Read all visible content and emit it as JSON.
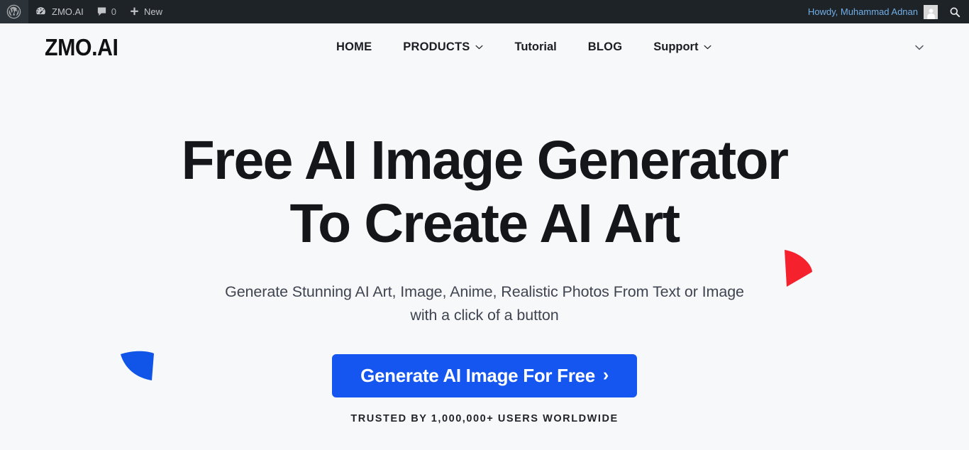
{
  "adminbar": {
    "wp_logo": "wordpress-logo",
    "site_name": "ZMO.AI",
    "comments_count": "0",
    "new_label": "New",
    "howdy": "Howdy, Muhammad Adnan",
    "search_icon": "search-icon",
    "colors": {
      "background": "#1d2327",
      "text": "#c3c4c7",
      "link": "#72aee6"
    }
  },
  "header": {
    "logo": "ZMO.AI",
    "nav": [
      {
        "label": "HOME",
        "has_dropdown": false,
        "style": "caps"
      },
      {
        "label": "PRODUCTS",
        "has_dropdown": true,
        "style": "caps"
      },
      {
        "label": "Tutorial",
        "has_dropdown": false,
        "style": "mixed"
      },
      {
        "label": "BLOG",
        "has_dropdown": false,
        "style": "caps"
      },
      {
        "label": "Support",
        "has_dropdown": true,
        "style": "mixed"
      }
    ],
    "right_toggle_icon": "chevron-down-icon"
  },
  "hero": {
    "headline_line1": "Free AI Image Generator",
    "headline_line2": "To Create AI Art",
    "subhead_line1": "Generate Stunning AI Art, Image, Anime, Realistic Photos From Text or Image",
    "subhead_line2": "with a click of a button",
    "cta_label": "Generate AI Image For Free",
    "cta_arrow": "›",
    "trusted_text": "TRUSTED BY 1,000,000+ USERS WORLDWIDE",
    "colors": {
      "background": "#f7f8fa",
      "headline": "#15161a",
      "subhead": "#3f4450",
      "cta_background": "#1556f0",
      "cta_text": "#ffffff",
      "accent_red": "#f5222d",
      "accent_blue": "#1155e8"
    },
    "decorations": [
      {
        "name": "red-wedge",
        "shape": "quarter-circle",
        "color": "#f5222d"
      },
      {
        "name": "blue-wedge",
        "shape": "quarter-circle",
        "color": "#1155e8"
      }
    ]
  }
}
